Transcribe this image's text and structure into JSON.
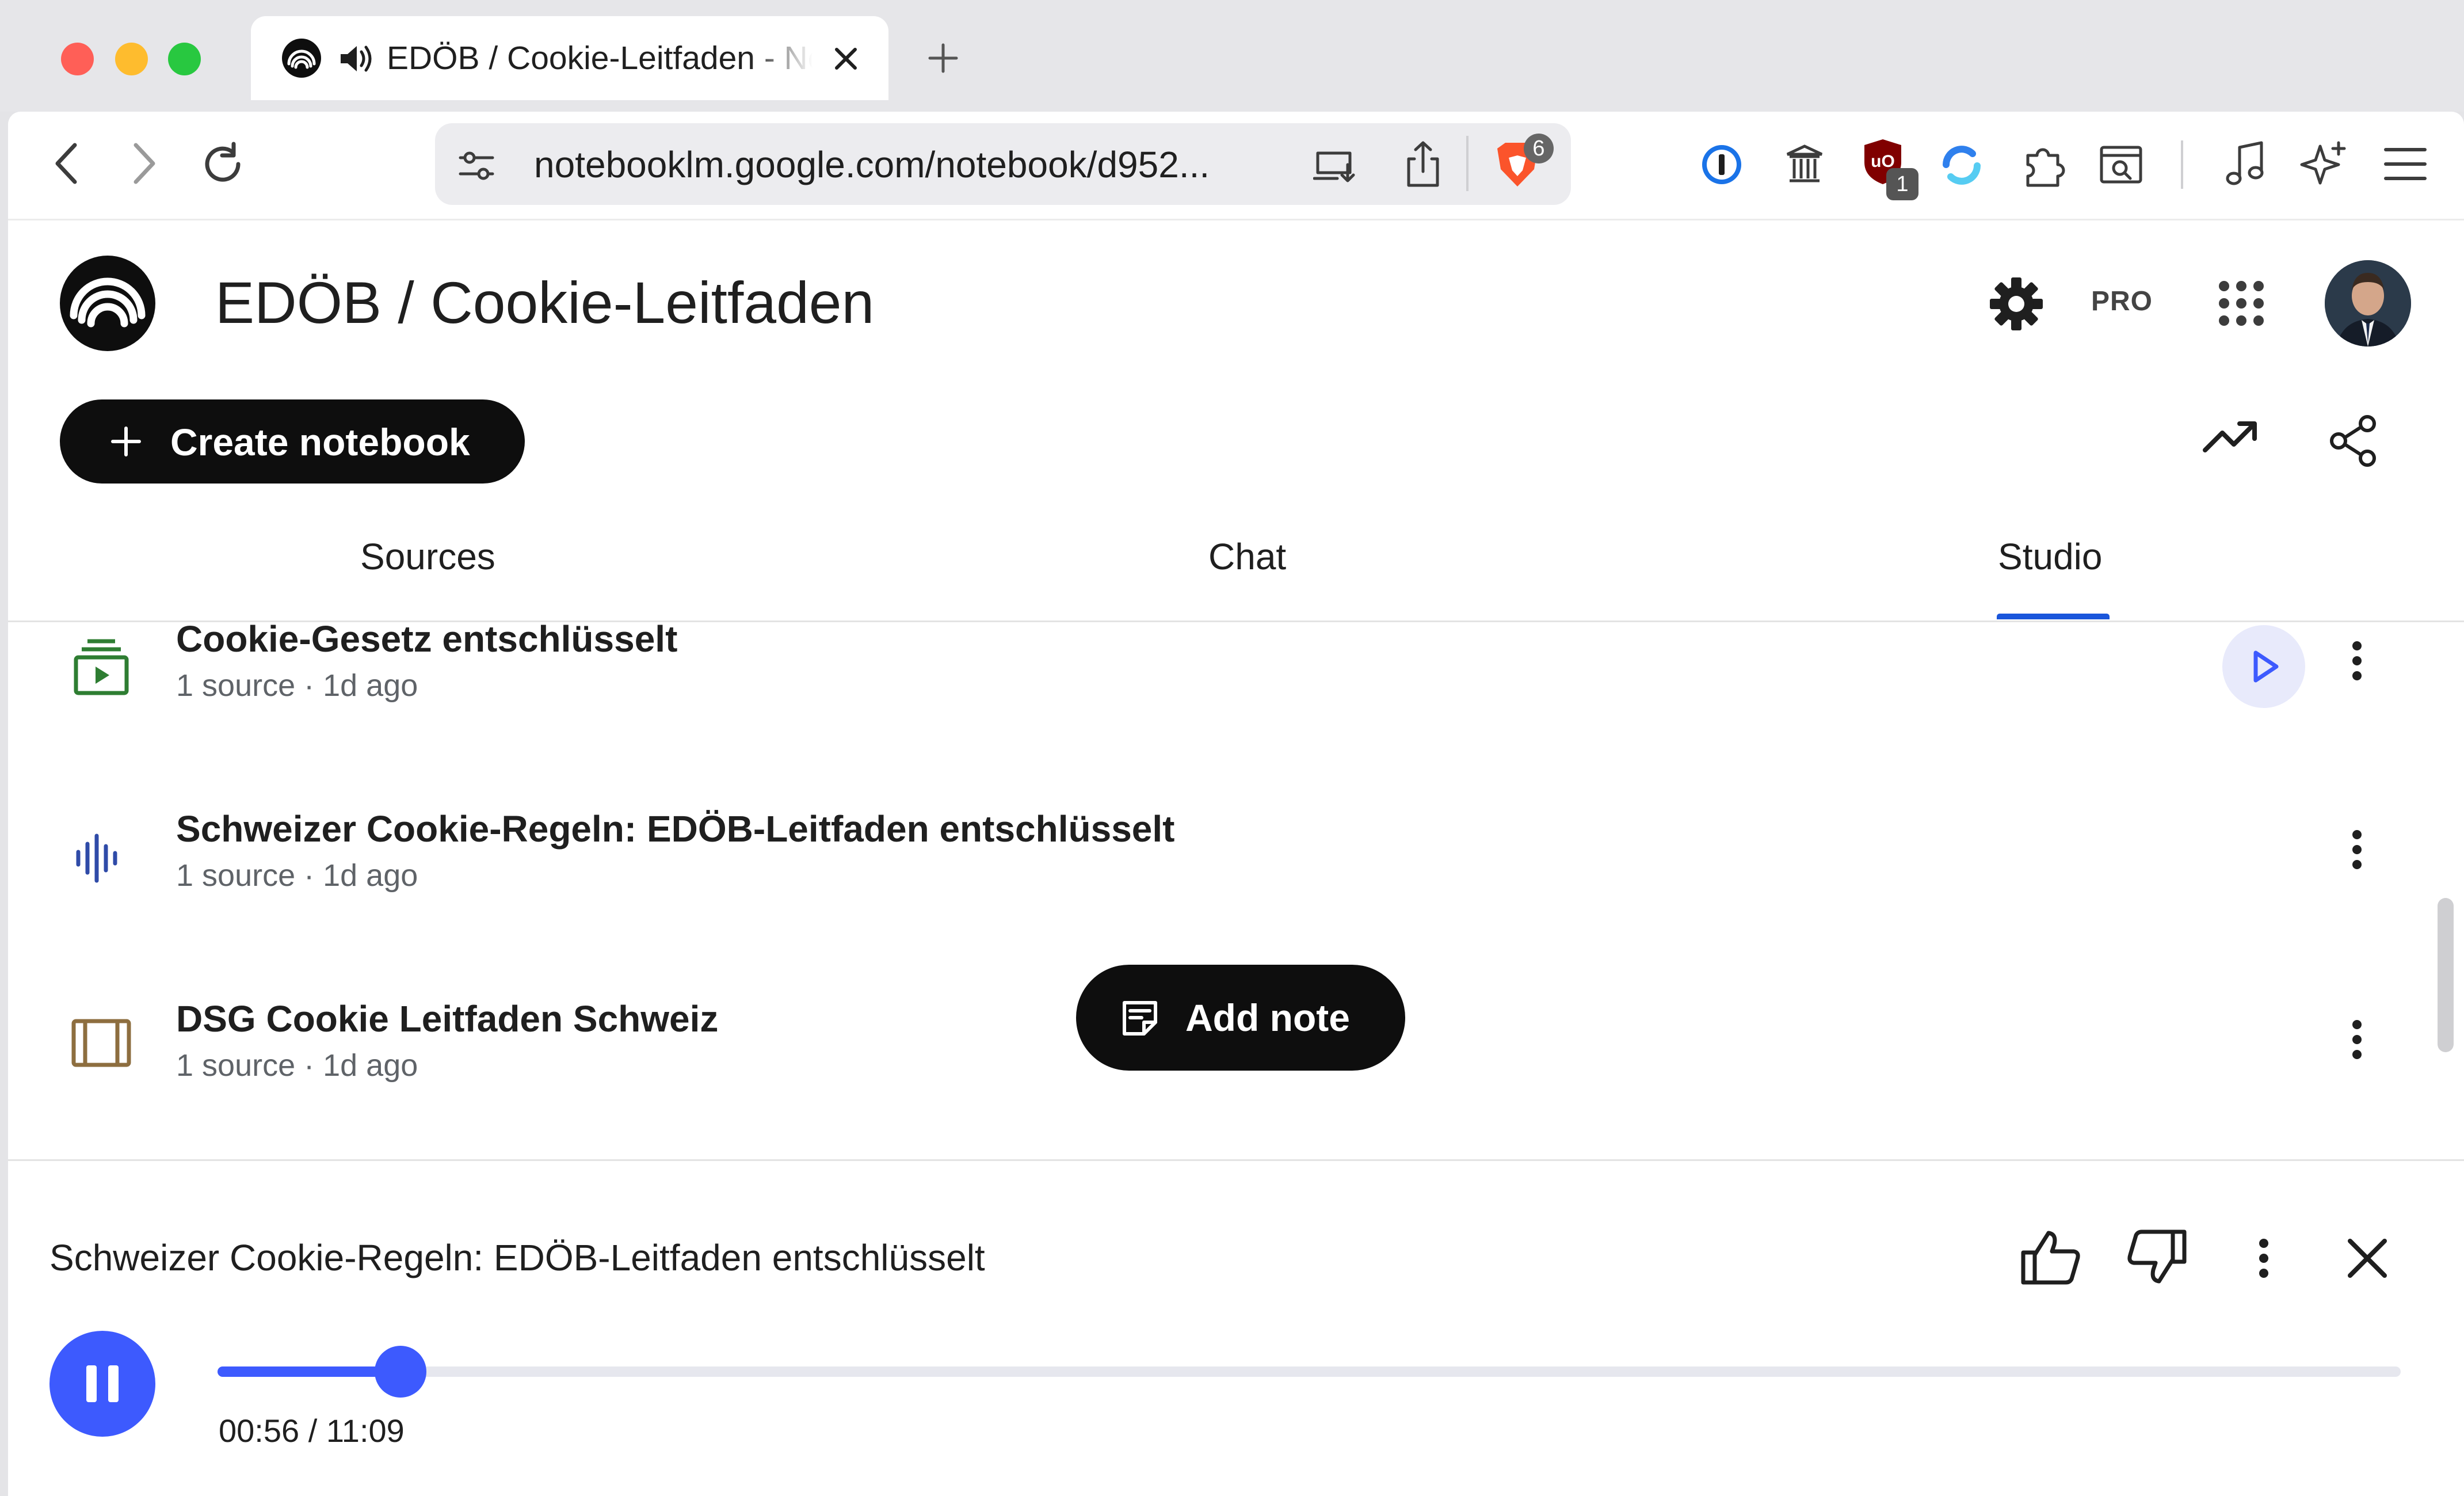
{
  "browser": {
    "tab_title": "EDÖB / Cookie-Leitfaden - NotebookLM",
    "new_tab_symbol": "+",
    "url": "notebooklm.google.com/notebook/d952...",
    "brave_badge": "6",
    "ublock_badge": "1"
  },
  "header": {
    "notebook_title": "EDÖB / Cookie-Leitfaden",
    "pro_label": "PRO"
  },
  "toolbar": {
    "create_label": "Create notebook"
  },
  "tabs": [
    {
      "label": "Sources"
    },
    {
      "label": "Chat"
    },
    {
      "label": "Studio",
      "active": true
    }
  ],
  "studio_items": [
    {
      "title": "Cookie-Gesetz entschlüsselt",
      "meta": "1 source · 1d ago",
      "icon": "video-overview-icon"
    },
    {
      "title": "Schweizer Cookie-Regeln: EDÖB-Leitfaden entschlüsselt",
      "meta": "1 source · 1d ago",
      "icon": "audio-overview-icon"
    },
    {
      "title": "DSG Cookie Leitfaden Schweiz",
      "meta": "1 source · 1d ago",
      "icon": "slides-icon"
    }
  ],
  "add_note_label": "Add note",
  "player": {
    "title": "Schweizer Cookie-Regeln: EDÖB-Leitfaden entschlüsselt",
    "time": "00:56 / 11:09",
    "progress": 0.0837
  },
  "colors": {
    "accent": "#3d5afe",
    "tab_underline": "#1a56db",
    "dark_button": "#0e0e0e"
  }
}
